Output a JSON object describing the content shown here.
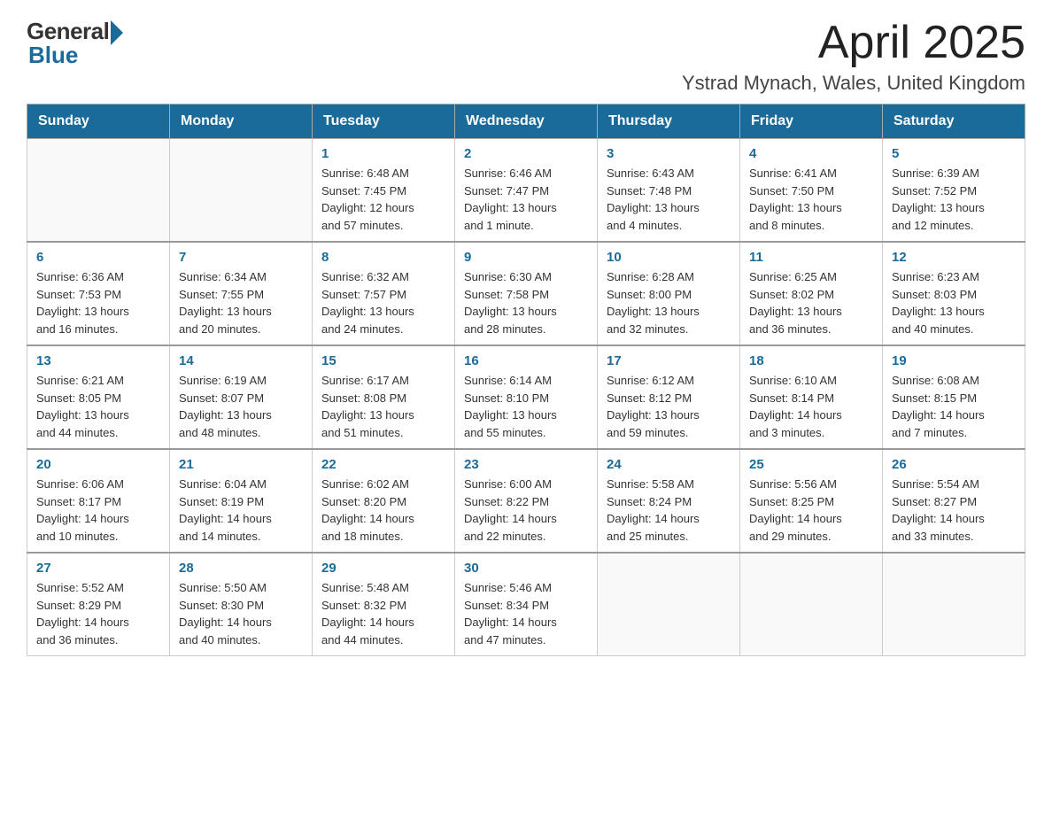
{
  "header": {
    "logo_general": "General",
    "logo_blue": "Blue",
    "month_year": "April 2025",
    "location": "Ystrad Mynach, Wales, United Kingdom"
  },
  "weekdays": [
    "Sunday",
    "Monday",
    "Tuesday",
    "Wednesday",
    "Thursday",
    "Friday",
    "Saturday"
  ],
  "weeks": [
    [
      {
        "day": "",
        "info": ""
      },
      {
        "day": "",
        "info": ""
      },
      {
        "day": "1",
        "info": "Sunrise: 6:48 AM\nSunset: 7:45 PM\nDaylight: 12 hours\nand 57 minutes."
      },
      {
        "day": "2",
        "info": "Sunrise: 6:46 AM\nSunset: 7:47 PM\nDaylight: 13 hours\nand 1 minute."
      },
      {
        "day": "3",
        "info": "Sunrise: 6:43 AM\nSunset: 7:48 PM\nDaylight: 13 hours\nand 4 minutes."
      },
      {
        "day": "4",
        "info": "Sunrise: 6:41 AM\nSunset: 7:50 PM\nDaylight: 13 hours\nand 8 minutes."
      },
      {
        "day": "5",
        "info": "Sunrise: 6:39 AM\nSunset: 7:52 PM\nDaylight: 13 hours\nand 12 minutes."
      }
    ],
    [
      {
        "day": "6",
        "info": "Sunrise: 6:36 AM\nSunset: 7:53 PM\nDaylight: 13 hours\nand 16 minutes."
      },
      {
        "day": "7",
        "info": "Sunrise: 6:34 AM\nSunset: 7:55 PM\nDaylight: 13 hours\nand 20 minutes."
      },
      {
        "day": "8",
        "info": "Sunrise: 6:32 AM\nSunset: 7:57 PM\nDaylight: 13 hours\nand 24 minutes."
      },
      {
        "day": "9",
        "info": "Sunrise: 6:30 AM\nSunset: 7:58 PM\nDaylight: 13 hours\nand 28 minutes."
      },
      {
        "day": "10",
        "info": "Sunrise: 6:28 AM\nSunset: 8:00 PM\nDaylight: 13 hours\nand 32 minutes."
      },
      {
        "day": "11",
        "info": "Sunrise: 6:25 AM\nSunset: 8:02 PM\nDaylight: 13 hours\nand 36 minutes."
      },
      {
        "day": "12",
        "info": "Sunrise: 6:23 AM\nSunset: 8:03 PM\nDaylight: 13 hours\nand 40 minutes."
      }
    ],
    [
      {
        "day": "13",
        "info": "Sunrise: 6:21 AM\nSunset: 8:05 PM\nDaylight: 13 hours\nand 44 minutes."
      },
      {
        "day": "14",
        "info": "Sunrise: 6:19 AM\nSunset: 8:07 PM\nDaylight: 13 hours\nand 48 minutes."
      },
      {
        "day": "15",
        "info": "Sunrise: 6:17 AM\nSunset: 8:08 PM\nDaylight: 13 hours\nand 51 minutes."
      },
      {
        "day": "16",
        "info": "Sunrise: 6:14 AM\nSunset: 8:10 PM\nDaylight: 13 hours\nand 55 minutes."
      },
      {
        "day": "17",
        "info": "Sunrise: 6:12 AM\nSunset: 8:12 PM\nDaylight: 13 hours\nand 59 minutes."
      },
      {
        "day": "18",
        "info": "Sunrise: 6:10 AM\nSunset: 8:14 PM\nDaylight: 14 hours\nand 3 minutes."
      },
      {
        "day": "19",
        "info": "Sunrise: 6:08 AM\nSunset: 8:15 PM\nDaylight: 14 hours\nand 7 minutes."
      }
    ],
    [
      {
        "day": "20",
        "info": "Sunrise: 6:06 AM\nSunset: 8:17 PM\nDaylight: 14 hours\nand 10 minutes."
      },
      {
        "day": "21",
        "info": "Sunrise: 6:04 AM\nSunset: 8:19 PM\nDaylight: 14 hours\nand 14 minutes."
      },
      {
        "day": "22",
        "info": "Sunrise: 6:02 AM\nSunset: 8:20 PM\nDaylight: 14 hours\nand 18 minutes."
      },
      {
        "day": "23",
        "info": "Sunrise: 6:00 AM\nSunset: 8:22 PM\nDaylight: 14 hours\nand 22 minutes."
      },
      {
        "day": "24",
        "info": "Sunrise: 5:58 AM\nSunset: 8:24 PM\nDaylight: 14 hours\nand 25 minutes."
      },
      {
        "day": "25",
        "info": "Sunrise: 5:56 AM\nSunset: 8:25 PM\nDaylight: 14 hours\nand 29 minutes."
      },
      {
        "day": "26",
        "info": "Sunrise: 5:54 AM\nSunset: 8:27 PM\nDaylight: 14 hours\nand 33 minutes."
      }
    ],
    [
      {
        "day": "27",
        "info": "Sunrise: 5:52 AM\nSunset: 8:29 PM\nDaylight: 14 hours\nand 36 minutes."
      },
      {
        "day": "28",
        "info": "Sunrise: 5:50 AM\nSunset: 8:30 PM\nDaylight: 14 hours\nand 40 minutes."
      },
      {
        "day": "29",
        "info": "Sunrise: 5:48 AM\nSunset: 8:32 PM\nDaylight: 14 hours\nand 44 minutes."
      },
      {
        "day": "30",
        "info": "Sunrise: 5:46 AM\nSunset: 8:34 PM\nDaylight: 14 hours\nand 47 minutes."
      },
      {
        "day": "",
        "info": ""
      },
      {
        "day": "",
        "info": ""
      },
      {
        "day": "",
        "info": ""
      }
    ]
  ]
}
